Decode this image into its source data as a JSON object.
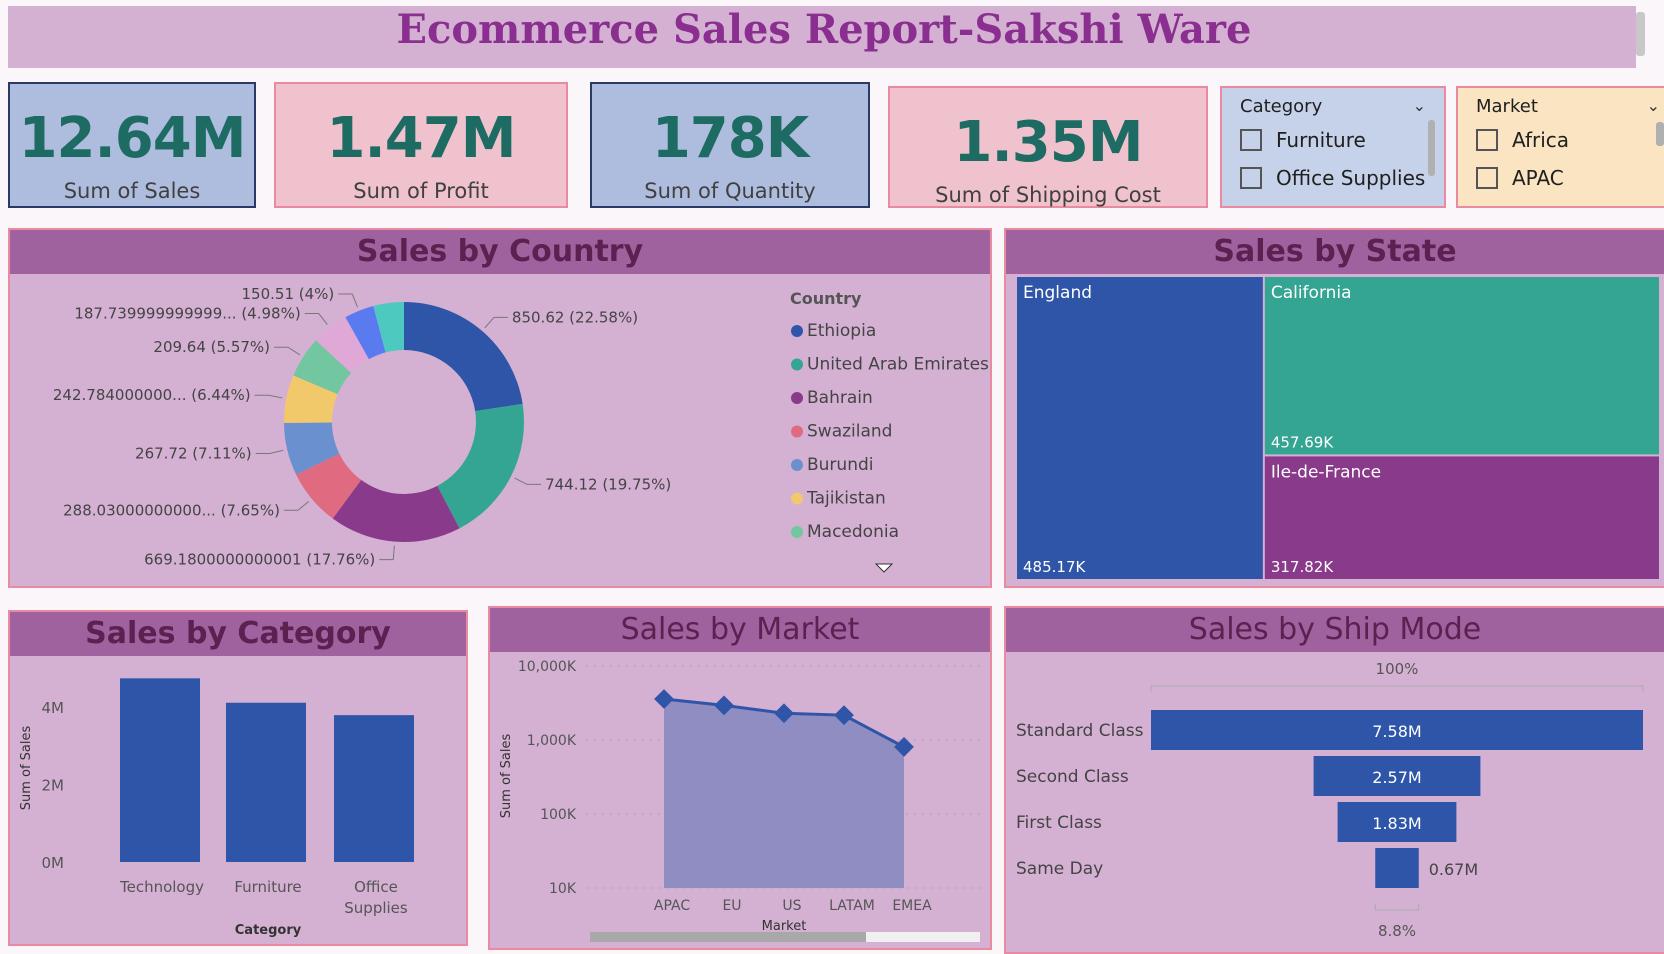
{
  "title": "Ecommerce Sales Report-Sakshi Ware",
  "kpis": [
    {
      "value": "12.64M",
      "label": "Sum of Sales"
    },
    {
      "value": "1.47M",
      "label": "Sum of Profit"
    },
    {
      "value": "178K",
      "label": "Sum of Quantity"
    },
    {
      "value": "1.35M",
      "label": "Sum of Shipping Cost"
    }
  ],
  "slicers": {
    "category": {
      "header": "Category",
      "options": [
        "Furniture",
        "Office Supplies"
      ]
    },
    "market": {
      "header": "Market",
      "options": [
        "Africa",
        "APAC"
      ]
    }
  },
  "panels": {
    "country": "Sales by Country",
    "state": "Sales by State",
    "category": "Sales by Category",
    "market": "Sales by Market",
    "shipmode": "Sales by Ship Mode"
  },
  "colors": {
    "accent": "#8a2f90",
    "kpi_value": "#1d6b62",
    "panel_bg": "#d4b1d3",
    "panel_header": "#a0629e",
    "bar": "#2f55a8"
  },
  "chart_data": [
    {
      "id": "donut",
      "type": "pie",
      "title": "Sales by Country",
      "legend_title": "Country",
      "legend": [
        "Ethiopia",
        "United Arab Emirates",
        "Bahrain",
        "Swaziland",
        "Burundi",
        "Tajikistan",
        "Macedonia"
      ],
      "slices": [
        {
          "value": 850.62,
          "label": "850.62 (22.58%)",
          "color": "#2f55a8"
        },
        {
          "value": 744.12,
          "label": "744.12 (19.75%)",
          "color": "#34a592"
        },
        {
          "value": 669.18,
          "label": "669.1800000000001 (17.76%)",
          "color": "#8a3a8a"
        },
        {
          "value": 288.03,
          "label": "288.03000000000... (7.65%)",
          "color": "#e06a80"
        },
        {
          "value": 267.72,
          "label": "267.72 (7.11%)",
          "color": "#6a90d0"
        },
        {
          "value": 242.784,
          "label": "242.784000000... (6.44%)",
          "color": "#f2c96a"
        },
        {
          "value": 209.64,
          "label": "209.64 (5.57%)",
          "color": "#72c7a0"
        },
        {
          "value": 187.74,
          "label": "187.739999999999... (4.98%)",
          "color": "#e0a8d6"
        },
        {
          "value": 150.51,
          "label": "150.51 (4%)",
          "color": "#5a7bf0"
        },
        {
          "value": 155.0,
          "label": "",
          "color": "#4ec9c0"
        }
      ],
      "legend_colors": [
        "#2f55a8",
        "#34a592",
        "#8a3a8a",
        "#e06a80",
        "#6a90d0",
        "#f2c96a",
        "#72c7a0"
      ]
    },
    {
      "id": "treemap",
      "type": "heatmap",
      "title": "Sales by State",
      "items": [
        {
          "name": "England",
          "value": 485.17,
          "label": "485.17K",
          "color": "#2f55a8"
        },
        {
          "name": "California",
          "value": 457.69,
          "label": "457.69K",
          "color": "#34a592"
        },
        {
          "name": "Ile-de-France",
          "value": 317.82,
          "label": "317.82K",
          "color": "#8a3a8a"
        }
      ]
    },
    {
      "id": "category-bars",
      "type": "bar",
      "title": "Sales by Category",
      "categories": [
        "Technology",
        "Furniture",
        "Office Supplies"
      ],
      "values": [
        4.74,
        4.11,
        3.79
      ],
      "xlabel": "Category",
      "ylabel": "Sum of Sales",
      "ylim": [
        0,
        4.8
      ],
      "ticks": [
        {
          "v": 0,
          "label": "0M"
        },
        {
          "v": 2,
          "label": "2M"
        },
        {
          "v": 4,
          "label": "4M"
        }
      ]
    },
    {
      "id": "market-area",
      "type": "area",
      "title": "Sales by Market",
      "categories": [
        "APAC",
        "EU",
        "US",
        "LATAM",
        "EMEA"
      ],
      "values": [
        3585000,
        2938000,
        2298000,
        2165000,
        806000
      ],
      "xlabel": "Market",
      "ylabel": "Sum of Sales",
      "scale": "log",
      "ylim": [
        10000,
        10000000
      ],
      "ticks": [
        {
          "v": 10000,
          "label": "10K"
        },
        {
          "v": 100000,
          "label": "100K"
        },
        {
          "v": 1000000,
          "label": "1,000K"
        },
        {
          "v": 10000000,
          "label": "10,000K"
        }
      ]
    },
    {
      "id": "shipmode-funnel",
      "type": "bar",
      "title": "Sales by Ship Mode",
      "categories": [
        "Standard Class",
        "Second Class",
        "First Class",
        "Same Day"
      ],
      "values": [
        7.58,
        2.57,
        1.83,
        0.67
      ],
      "labels": [
        "7.58M",
        "2.57M",
        "1.83M",
        "0.67M"
      ],
      "top_pct": "100%",
      "bottom_pct": "8.8%"
    }
  ]
}
